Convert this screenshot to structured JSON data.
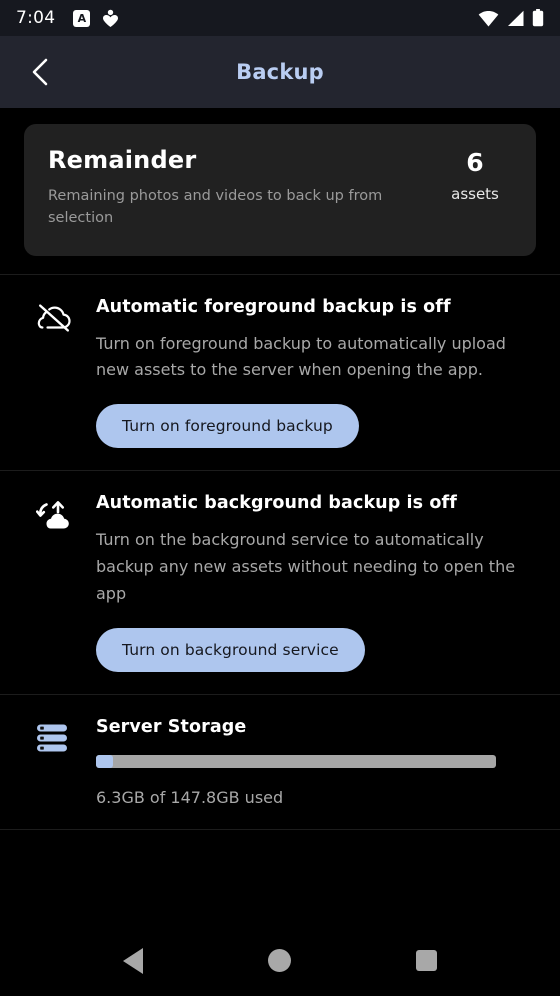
{
  "status_bar": {
    "time": "7:04",
    "left_icons": [
      {
        "name": "accessibility-badge-icon",
        "glyph": "A"
      },
      {
        "name": "heart-person-icon",
        "glyph": "heart"
      }
    ],
    "right_icons": [
      {
        "name": "wifi-icon"
      },
      {
        "name": "cellular-signal-icon"
      },
      {
        "name": "battery-icon"
      }
    ]
  },
  "app_bar": {
    "back_label": "Back",
    "title": "Backup",
    "title_color": "#b9cdf2"
  },
  "remainder_card": {
    "title": "Remainder",
    "subtitle": "Remaining photos and videos to back up from selection",
    "count": "6",
    "count_label": "assets"
  },
  "sections": [
    {
      "icon": "cloud-off-icon",
      "title": "Automatic foreground backup is off",
      "description": "Turn on foreground backup to automatically upload new assets to the server when opening the app.",
      "button_label": "Turn on foreground backup"
    },
    {
      "icon": "cloud-sync-icon",
      "title": "Automatic background backup is off",
      "description": "Turn on the background service to automatically backup any new assets without needing to open the app",
      "button_label": "Turn on background service"
    }
  ],
  "storage": {
    "icon": "server-storage-icon",
    "title": "Server Storage",
    "used_text": "6.3GB of 147.8GB used",
    "used_gb": 6.3,
    "total_gb": 147.8,
    "percent_used": 4.3,
    "fill_color": "#aec6ee",
    "track_color": "#a6a6a6"
  },
  "nav_bar": {
    "back_label": "Back",
    "home_label": "Home",
    "recents_label": "Recents"
  },
  "theme": {
    "background": "#000000",
    "appbar_background": "#23252f",
    "card_background": "#212121",
    "accent": "#aec6ee"
  }
}
